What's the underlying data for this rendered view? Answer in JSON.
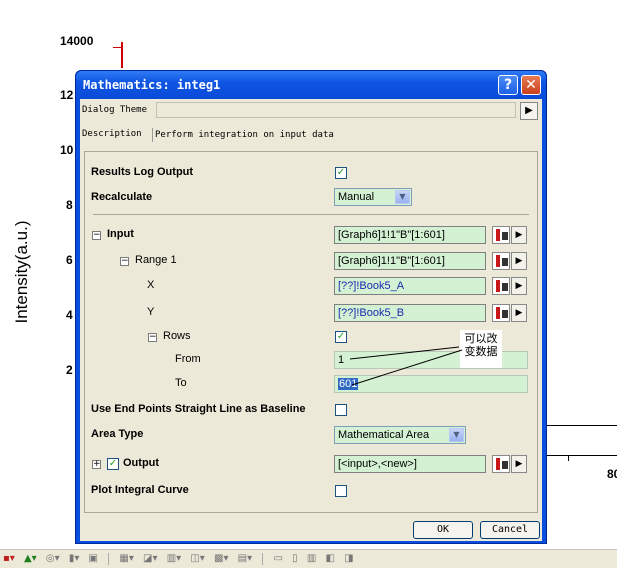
{
  "background": {
    "yaxis_top": "14000",
    "tick_12": "12",
    "tick_10": "10",
    "tick_8": "8",
    "tick_6": "6",
    "tick_4": "4",
    "tick_2": "2",
    "ylabel": "Intensity(a.u.)",
    "x_tick_right": "80"
  },
  "dialog": {
    "title": "Mathematics: integ1",
    "help": "?",
    "close": "✕",
    "theme_label": "Dialog Theme",
    "description_label": "Description",
    "description_text": "Perform integration on input data",
    "results_log_label": "Results Log Output",
    "results_log_checked": "✓",
    "recalculate_label": "Recalculate",
    "recalculate_value": "Manual",
    "input_label": "Input",
    "input_value": "[Graph6]1!1\"B\"[1:601]",
    "range1_label": "Range 1",
    "range1_value": "[Graph6]1!1\"B\"[1:601]",
    "x_label": "X",
    "x_value": "[??]!Book5_A",
    "y_label": "Y",
    "y_value": "[??]!Book5_B",
    "rows_label": "Rows",
    "rows_checked": "✓",
    "from_label": "From",
    "from_value": "1",
    "to_label": "To",
    "to_value": "601",
    "baseline_label": "Use End Points Straight Line as Baseline",
    "area_type_label": "Area Type",
    "area_type_value": "Mathematical Area",
    "output_label": "Output",
    "output_checked": "✓",
    "output_value": "[<input>,<new>]",
    "plot_curve_label": "Plot Integral Curve",
    "ok_label": "OK",
    "cancel_label": "Cancel",
    "annotation_line1": "可以改",
    "annotation_line2": "变数据",
    "expander_minus": "−",
    "expander_plus": "+",
    "dropdown_arrow": "▼",
    "play_arrow": "▶"
  }
}
